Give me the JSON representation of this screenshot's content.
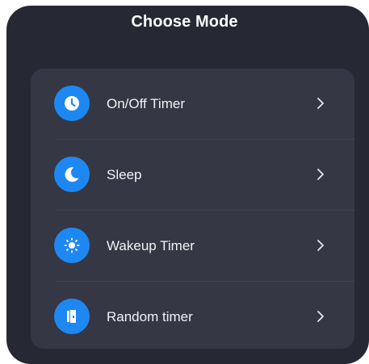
{
  "dialog": {
    "title": "Choose Mode"
  },
  "modes": [
    {
      "label": "On/Off Timer",
      "icon": "clock-icon"
    },
    {
      "label": "Sleep",
      "icon": "moon-icon"
    },
    {
      "label": "Wakeup Timer",
      "icon": "sun-icon"
    },
    {
      "label": "Random timer",
      "icon": "door-exit-icon"
    }
  ],
  "colors": {
    "background": "#262833",
    "card": "#353745",
    "accent": "#1e88f2",
    "text": "#f2f2f5"
  }
}
